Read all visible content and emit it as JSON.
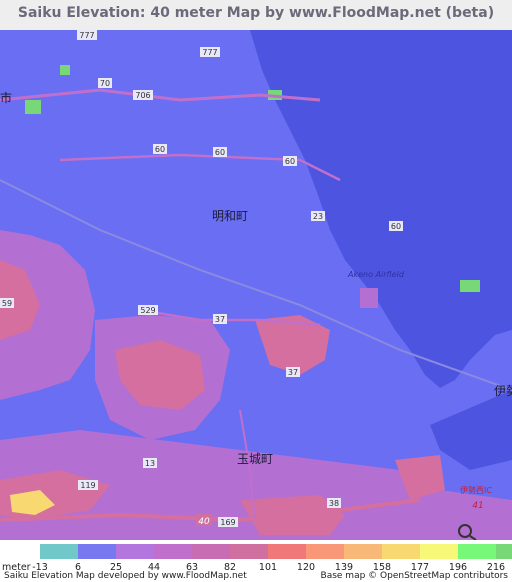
{
  "title": "Saiku Elevation: 40 meter Map by www.FloodMap.net (beta)",
  "map": {
    "town_labels": {
      "meiwa": "明和町",
      "tamaki": "玉城町",
      "ise_partial": "伊勢",
      "ise_nishi": "伊勢西IC",
      "shi_partial": "市"
    },
    "airfield": "Akeno Airfield",
    "road_labels": {
      "r777a": "777",
      "r777b": "777",
      "r706": "706",
      "r70": "70",
      "r60a": "60",
      "r60b": "60",
      "r60c": "60",
      "r60d": "60",
      "r23": "23",
      "r59": "59",
      "r529": "529",
      "r37a": "37",
      "r37b": "37",
      "r13": "13",
      "r119": "119",
      "r169": "169",
      "r38": "38",
      "r40": "40",
      "r41": "41"
    },
    "icons": [
      "search-icon"
    ],
    "colors": {
      "sea": "#4d55e0",
      "lowland": "#6a6ef2",
      "midland": "#b46fd2",
      "hill": "#d46fa0",
      "peak": "#f2874a"
    }
  },
  "legend": {
    "unit": "meter",
    "ticks": [
      "-13",
      "6",
      "25",
      "44",
      "63",
      "82",
      "101",
      "120",
      "139",
      "158",
      "177",
      "196",
      "216"
    ],
    "colors": [
      "#70c8c8",
      "#7878f0",
      "#b276de",
      "#c070cc",
      "#c86cb4",
      "#d070a0",
      "#f07878",
      "#f89878",
      "#f8b878",
      "#f8d870",
      "#f8f878",
      "#78f878",
      "#78d878"
    ]
  },
  "credits": {
    "left": "Saiku Elevation Map developed by www.FloodMap.net",
    "right": "Base map © OpenStreetMap contributors"
  }
}
